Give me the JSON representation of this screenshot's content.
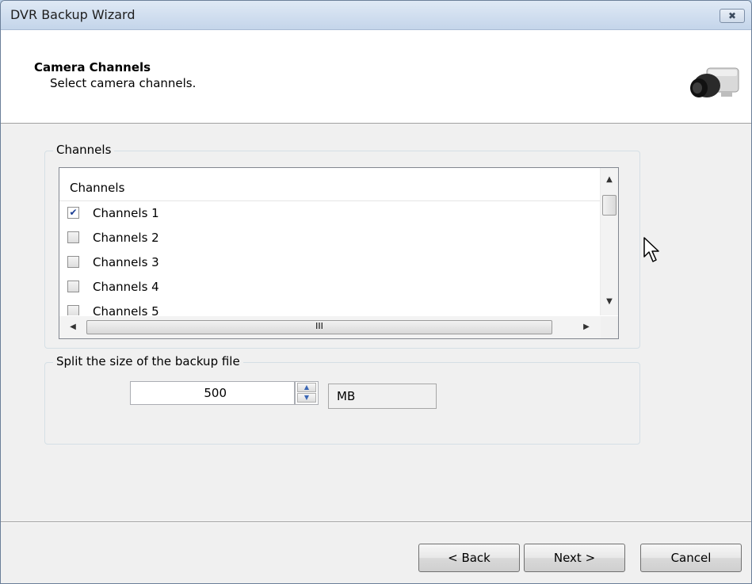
{
  "window": {
    "title": "DVR Backup Wizard",
    "close_glyph": "✖"
  },
  "header": {
    "title": "Camera Channels",
    "subtitle": "Select camera channels.",
    "icon": "camera-icon"
  },
  "channels_group": {
    "legend": "Channels",
    "list": {
      "column_header": "Channels",
      "items": [
        {
          "label": "Channels 1",
          "checked": true
        },
        {
          "label": "Channels 2",
          "checked": false
        },
        {
          "label": "Channels 3",
          "checked": false
        },
        {
          "label": "Channels 4",
          "checked": false
        },
        {
          "label": "Channels 5",
          "checked": false
        }
      ],
      "hscroll_grip": "III"
    }
  },
  "split_group": {
    "legend": "Split the size of the backup file",
    "value": "500",
    "unit": "MB"
  },
  "buttons": {
    "back": "< Back",
    "next": "Next >",
    "cancel": "Cancel"
  },
  "colors": {
    "accent": "#1c3f94",
    "title_bar": "#c4d5ea"
  }
}
